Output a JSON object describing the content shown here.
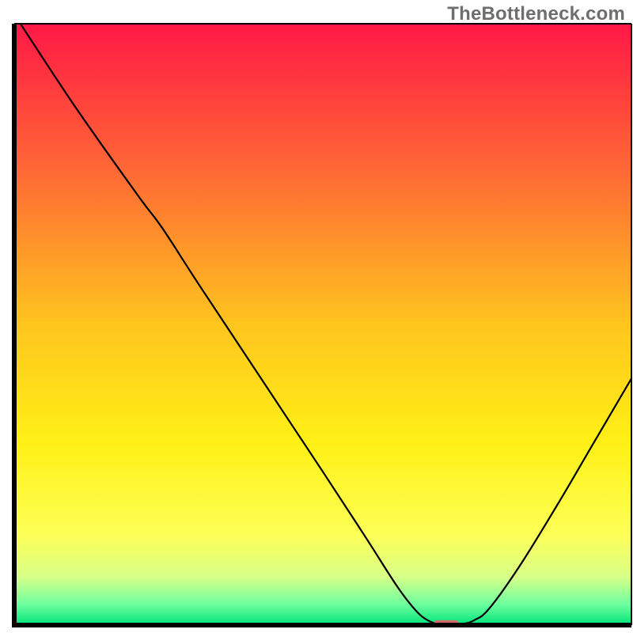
{
  "watermark": "TheBottleneck.com",
  "chart_data": {
    "type": "line",
    "title": "",
    "xlabel": "",
    "ylabel": "",
    "xlim": [
      0,
      100
    ],
    "ylim": [
      0,
      100
    ],
    "grid": false,
    "background_gradient": {
      "stops": [
        {
          "offset": 0.0,
          "color": "#ff1846"
        },
        {
          "offset": 0.25,
          "color": "#ff6a34"
        },
        {
          "offset": 0.5,
          "color": "#ffc51e"
        },
        {
          "offset": 0.7,
          "color": "#fff116"
        },
        {
          "offset": 0.85,
          "color": "#fdff57"
        },
        {
          "offset": 0.92,
          "color": "#d7ff88"
        },
        {
          "offset": 0.965,
          "color": "#6fff9f"
        },
        {
          "offset": 1.0,
          "color": "#00e47a"
        }
      ]
    },
    "curve": [
      {
        "x": 1.0,
        "y": 100.0
      },
      {
        "x": 10.0,
        "y": 86.0
      },
      {
        "x": 20.0,
        "y": 71.5
      },
      {
        "x": 24.0,
        "y": 66.0
      },
      {
        "x": 30.0,
        "y": 56.5
      },
      {
        "x": 40.0,
        "y": 41.0
      },
      {
        "x": 50.0,
        "y": 25.5
      },
      {
        "x": 57.0,
        "y": 14.5
      },
      {
        "x": 62.0,
        "y": 6.5
      },
      {
        "x": 65.0,
        "y": 2.5
      },
      {
        "x": 67.0,
        "y": 0.8
      },
      {
        "x": 69.0,
        "y": 0.2
      },
      {
        "x": 72.5,
        "y": 0.2
      },
      {
        "x": 74.5,
        "y": 0.8
      },
      {
        "x": 77.0,
        "y": 2.8
      },
      {
        "x": 82.0,
        "y": 10.0
      },
      {
        "x": 88.0,
        "y": 20.0
      },
      {
        "x": 94.0,
        "y": 30.5
      },
      {
        "x": 100.0,
        "y": 41.0
      }
    ],
    "marker": {
      "x": 70.0,
      "y": 0.3,
      "w": 4.0,
      "h": 1.0
    },
    "axes": {
      "origin": {
        "x": 0,
        "y": 0
      },
      "x_end": {
        "x": 100,
        "y": 0
      },
      "y_end": {
        "x": 0,
        "y": 100
      }
    }
  }
}
